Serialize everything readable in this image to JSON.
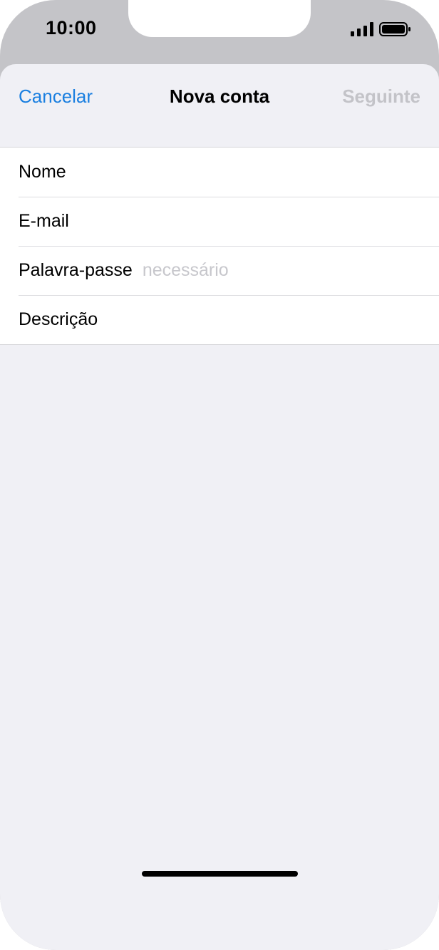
{
  "status_bar": {
    "time": "10:00",
    "signal_icon": "cellular-signal-icon",
    "battery_icon": "battery-icon"
  },
  "nav": {
    "cancel_label": "Cancelar",
    "title": "Nova conta",
    "next_label": "Seguinte"
  },
  "form": {
    "fields": [
      {
        "label": "Nome",
        "placeholder": ""
      },
      {
        "label": "E-mail",
        "placeholder": ""
      },
      {
        "label": "Palavra-passe",
        "placeholder": "necessário"
      },
      {
        "label": "Descrição",
        "placeholder": ""
      }
    ]
  },
  "colors": {
    "accent": "#1a7fe0",
    "disabled": "#c3c3c8",
    "background": "#f0f0f5",
    "placeholder": "#c7c7cc"
  }
}
